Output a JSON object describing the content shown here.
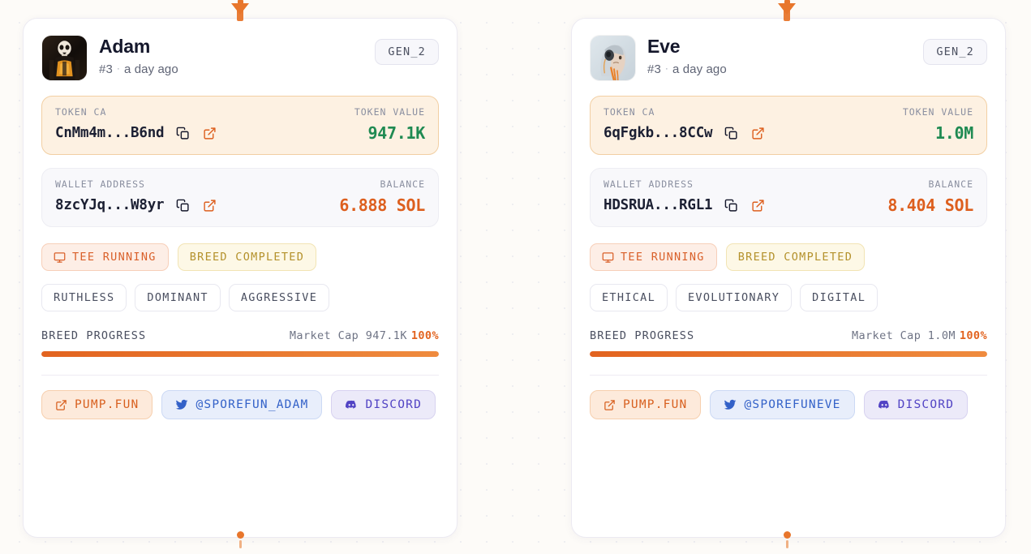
{
  "background": {
    "color": "#fdfbf8",
    "dot_color": "#e9e9ef",
    "accent": "#e8762c"
  },
  "markers": {
    "top_icon": "down-triangle-marker",
    "bottom_icon": "dot-marker"
  },
  "cards": [
    {
      "id": "adam",
      "avatar_icon": "skeleton-avatar",
      "name": "Adam",
      "rank": "#3",
      "separator": "·",
      "timestamp": "a day ago",
      "generation_badge": "GEN_2",
      "token": {
        "label": "TOKEN CA",
        "address": "CnMm4m...B6nd",
        "copy_icon": "copy-icon",
        "external_icon": "external-link-icon",
        "value_label": "TOKEN VALUE",
        "value": "947.1K",
        "value_color": "#1f8a52"
      },
      "wallet": {
        "label": "WALLET ADDRESS",
        "address": "8zcYJq...W8yr",
        "copy_icon": "copy-icon",
        "external_icon": "external-link-icon",
        "value_label": "BALANCE",
        "value": "6.888 SOL",
        "value_color": "#dd5f1e"
      },
      "status_chips": [
        {
          "icon": "monitor-icon",
          "label": "TEE RUNNING",
          "style": "tee"
        },
        {
          "icon": "",
          "label": "BREED COMPLETED",
          "style": "breed"
        }
      ],
      "traits": [
        "RUTHLESS",
        "DOMINANT",
        "AGGRESSIVE"
      ],
      "progress": {
        "title": "BREED PROGRESS",
        "meta": "Market Cap 947.1K",
        "percent_label": "100%",
        "percent_value": 100
      },
      "links": [
        {
          "icon": "external-link-icon",
          "label": "PUMP.FUN",
          "style": "pump"
        },
        {
          "icon": "twitter-icon",
          "label": "@SPOREFUN_ADAM",
          "style": "twitter"
        },
        {
          "icon": "discord-icon",
          "label": "DISCORD",
          "style": "discord"
        }
      ]
    },
    {
      "id": "eve",
      "avatar_icon": "android-head-avatar",
      "name": "Eve",
      "rank": "#3",
      "separator": "·",
      "timestamp": "a day ago",
      "generation_badge": "GEN_2",
      "token": {
        "label": "TOKEN CA",
        "address": "6qFgkb...8CCw",
        "copy_icon": "copy-icon",
        "external_icon": "external-link-icon",
        "value_label": "TOKEN VALUE",
        "value": "1.0M",
        "value_color": "#1f8a52"
      },
      "wallet": {
        "label": "WALLET ADDRESS",
        "address": "HDSRUA...RGL1",
        "copy_icon": "copy-icon",
        "external_icon": "external-link-icon",
        "value_label": "BALANCE",
        "value": "8.404 SOL",
        "value_color": "#dd5f1e"
      },
      "status_chips": [
        {
          "icon": "monitor-icon",
          "label": "TEE RUNNING",
          "style": "tee"
        },
        {
          "icon": "",
          "label": "BREED COMPLETED",
          "style": "breed"
        }
      ],
      "traits": [
        "ETHICAL",
        "EVOLUTIONARY",
        "DIGITAL"
      ],
      "progress": {
        "title": "BREED PROGRESS",
        "meta": "Market Cap 1.0M",
        "percent_label": "100%",
        "percent_value": 100
      },
      "links": [
        {
          "icon": "external-link-icon",
          "label": "PUMP.FUN",
          "style": "pump"
        },
        {
          "icon": "twitter-icon",
          "label": "@SPOREFUNEVE",
          "style": "twitter"
        },
        {
          "icon": "discord-icon",
          "label": "DISCORD",
          "style": "discord"
        }
      ]
    }
  ]
}
